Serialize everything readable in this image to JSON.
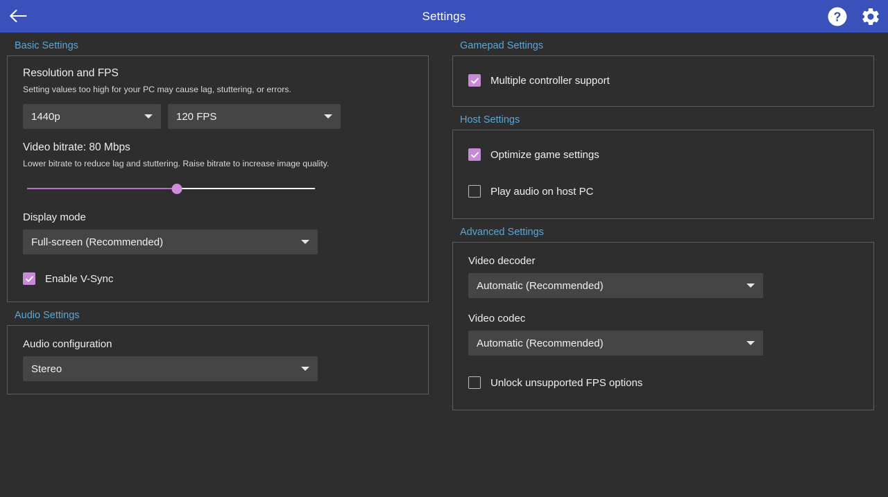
{
  "titlebar": {
    "title": "Settings",
    "back_icon": "back-arrow-icon",
    "help_icon": "help-circle-icon",
    "settings_icon": "gear-icon",
    "background_color": "#3a50ba"
  },
  "theme": {
    "background": "#2e2e2e",
    "section_header_color": "#5aa7d8",
    "accent_purple": "#c78ad6",
    "combo_background": "#454545",
    "groupbox_border": "#5e5e5e"
  },
  "left_column": {
    "basic_settings": {
      "section_label": "Basic Settings",
      "resolution_and_fps": {
        "title": "Resolution and FPS",
        "description": "Setting values too high for your PC may cause lag, stuttering, or errors.",
        "resolution_value": "1440p",
        "fps_value": "120 FPS"
      },
      "video_bitrate": {
        "title": "Video bitrate: 80 Mbps",
        "description": "Lower bitrate to reduce lag and stuttering. Raise bitrate to increase image quality.",
        "value": 80,
        "percent": 52
      },
      "display_mode": {
        "label": "Display mode",
        "value": "Full-screen (Recommended)"
      },
      "vsync": {
        "label": "Enable V-Sync",
        "checked": true
      }
    },
    "audio_settings": {
      "section_label": "Audio Settings",
      "audio_configuration": {
        "label": "Audio configuration",
        "value": "Stereo"
      }
    }
  },
  "right_column": {
    "gamepad_settings": {
      "section_label": "Gamepad Settings",
      "multiple_controller_support": {
        "label": "Multiple controller support",
        "checked": true
      }
    },
    "host_settings": {
      "section_label": "Host Settings",
      "optimize_game_settings": {
        "label": "Optimize game settings",
        "checked": true
      },
      "play_audio_on_host_pc": {
        "label": "Play audio on host PC",
        "checked": false
      }
    },
    "advanced_settings": {
      "section_label": "Advanced Settings",
      "video_decoder": {
        "label": "Video decoder",
        "value": "Automatic (Recommended)"
      },
      "video_codec": {
        "label": "Video codec",
        "value": "Automatic (Recommended)"
      },
      "unlock_unsupported_fps": {
        "label": "Unlock unsupported FPS options",
        "checked": false
      }
    }
  }
}
